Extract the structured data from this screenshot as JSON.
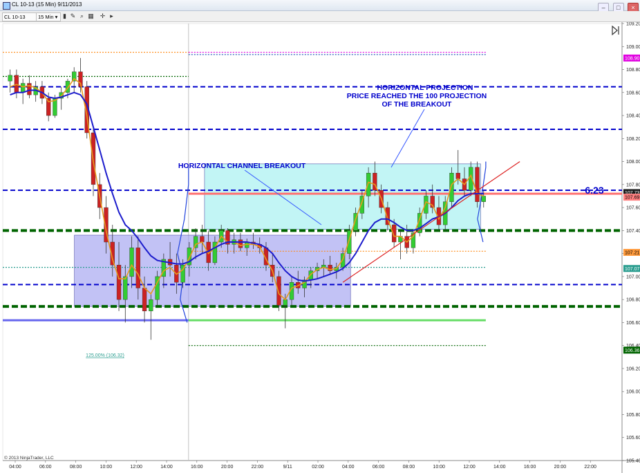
{
  "window": {
    "title": "CL 10-13 (15 Min)  9/11/2013",
    "min": "–",
    "max": "□",
    "close": "×"
  },
  "toolbar": {
    "instrument": "CL 10-13",
    "interval": "15 Min",
    "dropdown": "▾"
  },
  "icons": [
    "pencil-icon",
    "zoom-icon",
    "properties-icon",
    "crosshair-icon",
    "toggle-icon"
  ],
  "chart_data": {
    "type": "candlestick",
    "x_ticks": [
      "04:00",
      "06:00",
      "08:00",
      "10:00",
      "12:00",
      "14:00",
      "16:00",
      "20:00",
      "22:00",
      "9/11",
      "02:00",
      "04:00",
      "06:00",
      "08:00",
      "10:00",
      "12:00",
      "14:00",
      "16:00",
      "20:00",
      "22:00"
    ],
    "y_ticks": [
      "109.20",
      "109.00",
      "108.80",
      "108.60",
      "108.40",
      "108.20",
      "108.00",
      "107.80",
      "107.60",
      "107.40",
      "107.20",
      "107.00",
      "106.80",
      "106.60",
      "106.40",
      "106.20",
      "106.00",
      "105.80",
      "105.60",
      "105.40"
    ],
    "ylim": [
      105.4,
      109.2
    ],
    "price_tags": [
      {
        "value": "108.90",
        "color": "#e000e0",
        "text_color": "#ffffff"
      },
      {
        "value": "107.73",
        "color": "#1a1a1a",
        "text_color": "#ffffff"
      },
      {
        "value": "107.69",
        "color": "#ff8080",
        "text_color": "#000000"
      },
      {
        "value": "107.21",
        "color": "#ff9a3c",
        "text_color": "#000000"
      },
      {
        "value": "107.07",
        "color": "#2a9d8f",
        "text_color": "#ffffff"
      },
      {
        "value": "106.36",
        "color": "#006400",
        "text_color": "#ffffff"
      }
    ],
    "annotations": [
      {
        "text": "HORIZONTAL PROJECTION",
        "color": "#0000cc"
      },
      {
        "text": "PRICE REACHED THE 100 PROJECTION",
        "color": "#0000cc"
      },
      {
        "text": "OF THE BREAKOUT",
        "color": "#0000cc"
      },
      {
        "text": "HORIZONTAL CHANNEL BREAKOUT",
        "color": "#0000cc"
      }
    ],
    "big_label": "6.23",
    "fib_label": "125.00% (106.32)",
    "horizontal_lines": [
      {
        "value": 108.95,
        "color": "#ff8c1a",
        "style": "dotted",
        "x": [
          0,
          0.3
        ]
      },
      {
        "value": 108.95,
        "color": "#e000e0",
        "style": "dotted",
        "x": [
          0.3,
          0.78
        ]
      },
      {
        "value": 108.93,
        "color": "#2b5fbf",
        "style": "dotted",
        "x": [
          0.3,
          0.78
        ]
      },
      {
        "value": 108.74,
        "color": "#006400",
        "style": "dotted",
        "x": [
          0,
          0.3
        ]
      },
      {
        "value": 108.65,
        "color": "#0000cc",
        "style": "dashed",
        "x": [
          0,
          1
        ]
      },
      {
        "value": 108.28,
        "color": "#0000cc",
        "style": "dashed",
        "x": [
          0,
          1
        ]
      },
      {
        "value": 107.75,
        "color": "#0000cc",
        "style": "dashed",
        "x": [
          0,
          1
        ]
      },
      {
        "value": 107.72,
        "color": "#ff7070",
        "style": "solid",
        "x": [
          0.3,
          1
        ]
      },
      {
        "value": 107.4,
        "color": "#006400",
        "style": "dashed-thick",
        "x": [
          0,
          1
        ]
      },
      {
        "value": 107.22,
        "color": "#ff8c1a",
        "style": "dotted",
        "x": [
          0.3,
          0.78
        ]
      },
      {
        "value": 107.08,
        "color": "#2a9d8f",
        "style": "dotted",
        "x": [
          0,
          0.78
        ]
      },
      {
        "value": 106.93,
        "color": "#0000cc",
        "style": "dashed",
        "x": [
          0,
          1
        ]
      },
      {
        "value": 106.74,
        "color": "#006400",
        "style": "dashed-thick",
        "x": [
          0,
          1
        ]
      },
      {
        "value": 106.62,
        "color": "#6666ee",
        "style": "solid",
        "x": [
          0,
          0.3
        ]
      },
      {
        "value": 106.62,
        "color": "#66dd66",
        "style": "solid",
        "x": [
          0.3,
          0.78
        ]
      },
      {
        "value": 106.4,
        "color": "#006400",
        "style": "dotted",
        "x": [
          0.3,
          0.78
        ]
      }
    ],
    "boxes": [
      {
        "x0": 0.1156,
        "x1": 0.5616,
        "y0": 106.74,
        "y1": 107.36,
        "fill": "#9999ee",
        "opacity": 0.6
      },
      {
        "x0": 0.3258,
        "x1": 0.7716,
        "y0": 107.41,
        "y1": 107.98,
        "fill": "#99eeee",
        "opacity": 0.6
      }
    ],
    "candles": [
      [
        108.7,
        108.8,
        108.6,
        108.75
      ],
      [
        108.75,
        108.8,
        108.55,
        108.6
      ],
      [
        108.6,
        108.72,
        108.5,
        108.68
      ],
      [
        108.68,
        108.75,
        108.55,
        108.58
      ],
      [
        108.58,
        108.7,
        108.52,
        108.65
      ],
      [
        108.65,
        108.7,
        108.5,
        108.55
      ],
      [
        108.55,
        108.6,
        108.35,
        108.4
      ],
      [
        108.4,
        108.58,
        108.38,
        108.55
      ],
      [
        108.55,
        108.65,
        108.45,
        108.6
      ],
      [
        108.6,
        108.72,
        108.55,
        108.7
      ],
      [
        108.7,
        108.82,
        108.6,
        108.78
      ],
      [
        108.78,
        108.9,
        108.6,
        108.65
      ],
      [
        108.65,
        108.7,
        108.2,
        108.25
      ],
      [
        108.25,
        108.3,
        107.7,
        107.8
      ],
      [
        107.8,
        107.9,
        107.5,
        107.6
      ],
      [
        107.6,
        107.7,
        107.2,
        107.3
      ],
      [
        107.3,
        107.45,
        107.0,
        107.1
      ],
      [
        107.1,
        107.3,
        106.7,
        106.8
      ],
      [
        106.8,
        107.1,
        106.6,
        107.0
      ],
      [
        107.0,
        107.35,
        106.9,
        107.25
      ],
      [
        107.25,
        107.35,
        106.8,
        106.9
      ],
      [
        106.9,
        107.0,
        106.6,
        106.7
      ],
      [
        106.7,
        106.85,
        106.45,
        106.8
      ],
      [
        106.8,
        107.05,
        106.75,
        107.0
      ],
      [
        107.0,
        107.2,
        106.9,
        107.15
      ],
      [
        107.15,
        107.3,
        107.0,
        107.1
      ],
      [
        107.1,
        107.2,
        106.85,
        106.95
      ],
      [
        106.95,
        107.15,
        106.9,
        107.1
      ],
      [
        107.1,
        107.3,
        107.0,
        107.25
      ],
      [
        107.25,
        107.42,
        107.15,
        107.35
      ],
      [
        107.35,
        107.45,
        107.2,
        107.3
      ],
      [
        107.3,
        107.4,
        107.05,
        107.12
      ],
      [
        107.12,
        107.35,
        107.1,
        107.3
      ],
      [
        107.3,
        107.45,
        107.25,
        107.4
      ],
      [
        107.4,
        107.42,
        107.2,
        107.28
      ],
      [
        107.28,
        107.38,
        107.2,
        107.32
      ],
      [
        107.32,
        107.38,
        107.22,
        107.25
      ],
      [
        107.25,
        107.33,
        107.18,
        107.3
      ],
      [
        107.3,
        107.38,
        107.24,
        107.28
      ],
      [
        107.28,
        107.34,
        107.2,
        107.25
      ],
      [
        107.25,
        107.3,
        107.05,
        107.1
      ],
      [
        107.1,
        107.2,
        106.95,
        107.0
      ],
      [
        107.0,
        107.05,
        106.7,
        106.75
      ],
      [
        106.75,
        106.85,
        106.55,
        106.8
      ],
      [
        106.8,
        107.0,
        106.75,
        106.95
      ],
      [
        106.95,
        107.05,
        106.85,
        106.9
      ],
      [
        106.9,
        107.0,
        106.82,
        106.97
      ],
      [
        106.97,
        107.08,
        106.9,
        107.05
      ],
      [
        107.05,
        107.12,
        106.98,
        107.08
      ],
      [
        107.08,
        107.15,
        107.0,
        107.1
      ],
      [
        107.1,
        107.18,
        107.02,
        107.05
      ],
      [
        107.05,
        107.12,
        106.98,
        107.08
      ],
      [
        107.08,
        107.25,
        107.05,
        107.2
      ],
      [
        107.2,
        107.45,
        107.15,
        107.4
      ],
      [
        107.4,
        107.6,
        107.35,
        107.55
      ],
      [
        107.55,
        107.75,
        107.5,
        107.7
      ],
      [
        107.7,
        107.95,
        107.6,
        107.9
      ],
      [
        107.9,
        108.0,
        107.7,
        107.75
      ],
      [
        107.75,
        107.8,
        107.55,
        107.6
      ],
      [
        107.6,
        107.65,
        107.4,
        107.45
      ],
      [
        107.45,
        107.5,
        107.25,
        107.3
      ],
      [
        107.3,
        107.4,
        107.15,
        107.35
      ],
      [
        107.35,
        107.45,
        107.2,
        107.25
      ],
      [
        107.25,
        107.4,
        107.2,
        107.38
      ],
      [
        107.38,
        107.6,
        107.35,
        107.55
      ],
      [
        107.55,
        107.75,
        107.5,
        107.7
      ],
      [
        107.7,
        107.8,
        107.55,
        107.6
      ],
      [
        107.6,
        107.7,
        107.4,
        107.45
      ],
      [
        107.45,
        107.7,
        107.4,
        107.65
      ],
      [
        107.65,
        107.95,
        107.6,
        107.9
      ],
      [
        107.9,
        108.1,
        107.8,
        107.85
      ],
      [
        107.85,
        107.95,
        107.7,
        107.75
      ],
      [
        107.75,
        108.0,
        107.7,
        107.95
      ],
      [
        107.95,
        108.0,
        107.6,
        107.65
      ],
      [
        107.65,
        107.75,
        107.6,
        107.7
      ]
    ],
    "ma_blue": [
      108.58,
      108.6,
      108.6,
      108.62,
      108.62,
      108.6,
      108.56,
      108.55,
      108.56,
      108.58,
      108.6,
      108.58,
      108.5,
      108.3,
      108.1,
      107.9,
      107.72,
      107.56,
      107.45,
      107.4,
      107.33,
      107.25,
      107.18,
      107.14,
      107.13,
      107.12,
      107.11,
      107.11,
      107.13,
      107.17,
      107.2,
      107.22,
      107.25,
      107.28,
      107.3,
      107.3,
      107.3,
      107.3,
      107.29,
      107.28,
      107.25,
      107.2,
      107.12,
      107.05,
      107.0,
      106.97,
      106.96,
      106.97,
      106.98,
      107.0,
      107.02,
      107.04,
      107.07,
      107.12,
      107.2,
      107.3,
      107.4,
      107.47,
      107.5,
      107.5,
      107.47,
      107.43,
      107.4,
      107.4,
      107.42,
      107.46,
      107.5,
      107.52,
      107.55,
      107.6,
      107.66,
      107.7,
      107.72,
      107.72,
      107.72
    ],
    "ma_orange": [
      108.65,
      108.67,
      108.65,
      108.66,
      108.64,
      108.6,
      108.52,
      108.53,
      108.57,
      108.64,
      108.72,
      108.68,
      108.4,
      108.0,
      107.7,
      107.4,
      107.15,
      106.98,
      106.98,
      107.1,
      107.02,
      106.9,
      106.85,
      106.95,
      107.05,
      107.08,
      107.02,
      107.06,
      107.16,
      107.28,
      107.3,
      107.2,
      107.25,
      107.35,
      107.3,
      107.3,
      107.27,
      107.28,
      107.28,
      107.26,
      107.15,
      107.05,
      106.85,
      106.8,
      106.9,
      106.92,
      106.95,
      107.02,
      107.06,
      107.08,
      107.06,
      107.07,
      107.15,
      107.32,
      107.5,
      107.65,
      107.82,
      107.8,
      107.68,
      107.5,
      107.35,
      107.35,
      107.3,
      107.35,
      107.5,
      107.65,
      107.62,
      107.5,
      107.6,
      107.8,
      107.85,
      107.8,
      107.88,
      107.72,
      107.7
    ]
  },
  "copyright": "© 2013 NinjaTrader, LLC"
}
